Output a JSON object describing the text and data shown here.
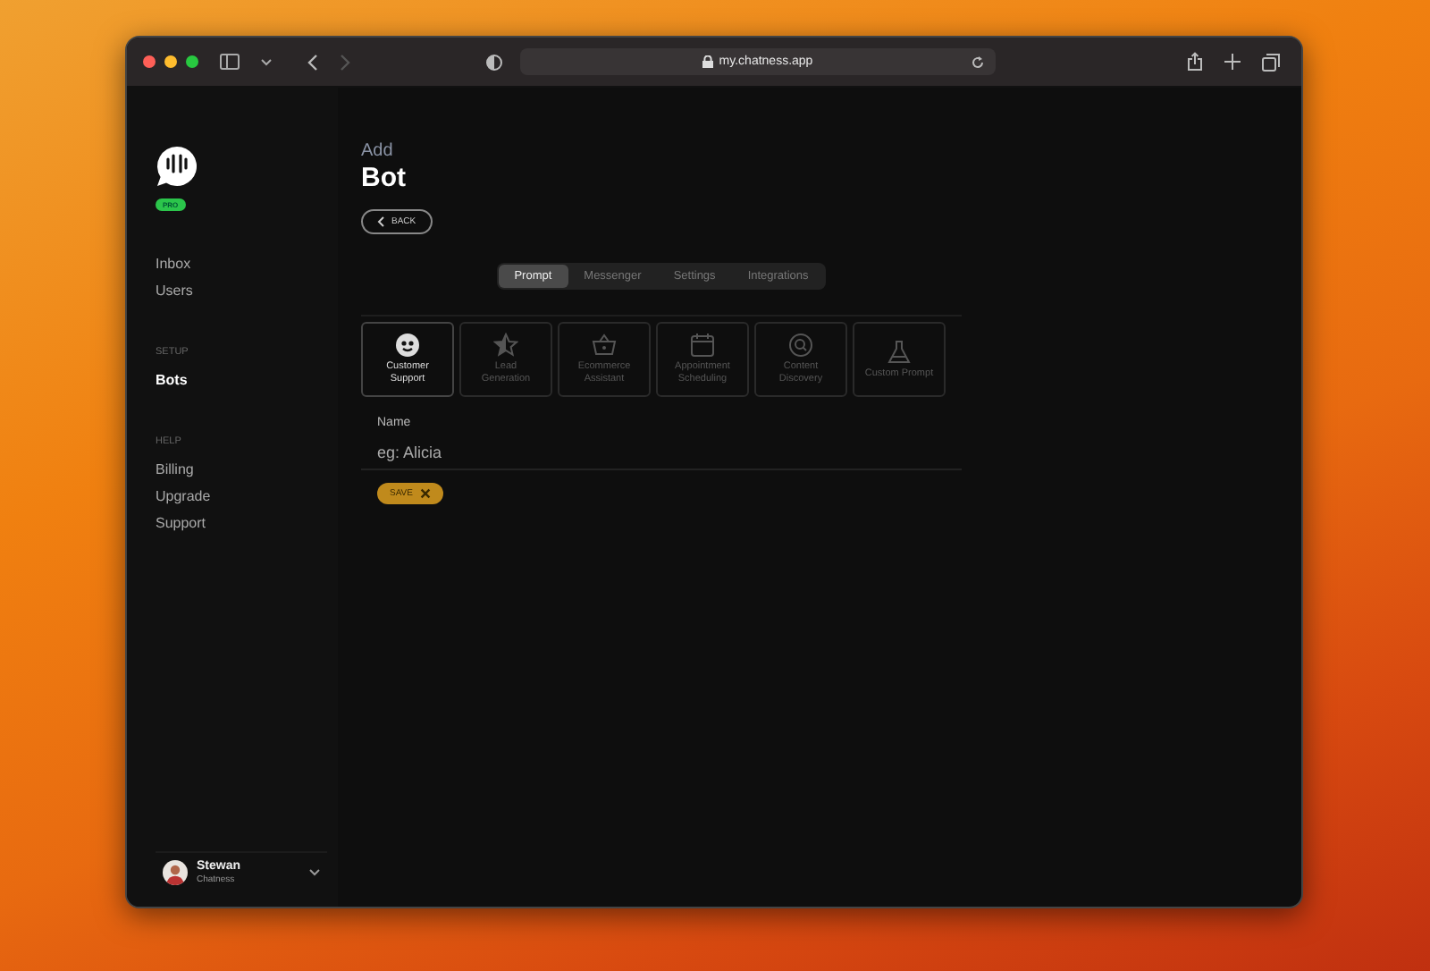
{
  "browser": {
    "url": "my.chatness.app"
  },
  "sidebar": {
    "badge": "PRO",
    "sections": [
      {
        "items": [
          {
            "label": "Inbox",
            "selected": false
          },
          {
            "label": "Users",
            "selected": false
          }
        ]
      },
      {
        "heading": "SETUP",
        "items": [
          {
            "label": "Bots",
            "selected": true
          }
        ]
      },
      {
        "heading": "HELP",
        "items": [
          {
            "label": "Billing",
            "selected": false
          },
          {
            "label": "Upgrade",
            "selected": false
          },
          {
            "label": "Support",
            "selected": false
          }
        ]
      }
    ],
    "user": {
      "name": "Stewan",
      "org": "Chatness"
    }
  },
  "page": {
    "overline": "Add",
    "title": "Bot",
    "back": "BACK"
  },
  "tabs": [
    {
      "label": "Prompt",
      "selected": true
    },
    {
      "label": "Messenger",
      "selected": false
    },
    {
      "label": "Settings",
      "selected": false
    },
    {
      "label": "Integrations",
      "selected": false
    }
  ],
  "templates": [
    {
      "kind": "support",
      "label": "Customer Support",
      "selected": true
    },
    {
      "kind": "lead",
      "label": "Lead Generation",
      "selected": false
    },
    {
      "kind": "ecommerce",
      "label": "Ecommerce Assistant",
      "selected": false
    },
    {
      "kind": "appointment",
      "label": "Appointment Scheduling",
      "selected": false
    },
    {
      "kind": "discovery",
      "label": "Content Discovery",
      "selected": false
    },
    {
      "kind": "custom",
      "label": "Custom Prompt",
      "selected": false
    }
  ],
  "form": {
    "label": "Name",
    "placeholder": "eg: Alicia",
    "save": "SAVE"
  }
}
